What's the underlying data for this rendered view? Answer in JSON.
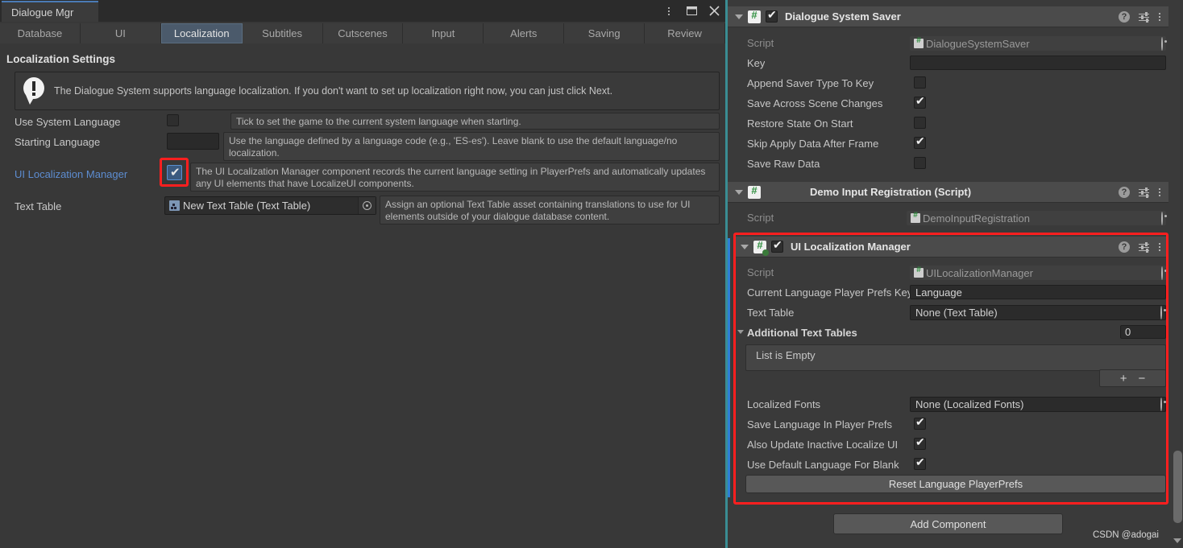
{
  "left_window": {
    "tab_label": "Dialogue Mgr",
    "window_buttons": {
      "menu": "⋮",
      "maximize": "❐",
      "close": "✕"
    },
    "toolbar_tabs": [
      {
        "label": "Database",
        "active": false
      },
      {
        "label": "UI",
        "active": false
      },
      {
        "label": "Localization",
        "active": true
      },
      {
        "label": "Subtitles",
        "active": false
      },
      {
        "label": "Cutscenes",
        "active": false
      },
      {
        "label": "Input",
        "active": false
      },
      {
        "label": "Alerts",
        "active": false
      },
      {
        "label": "Saving",
        "active": false
      },
      {
        "label": "Review",
        "active": false
      }
    ],
    "section_title": "Localization Settings",
    "help_text": "The Dialogue System supports language localization. If you don't want to set up localization right now, you can just click Next.",
    "fields": {
      "use_system_language": {
        "label": "Use System Language",
        "checked": false,
        "tip": "Tick to set the game to the current system language when starting."
      },
      "starting_language": {
        "label": "Starting Language",
        "value": "",
        "tip": "Use the language defined by a language code (e.g., 'ES-es'). Leave blank to use the default language/no localization."
      },
      "ui_localization_manager": {
        "label": "UI Localization Manager",
        "checked": true,
        "highlighted": true,
        "tip": "The UI Localization Manager component records the current language setting in PlayerPrefs and automatically updates any UI elements that have LocalizeUI components."
      },
      "text_table": {
        "label": "Text Table",
        "value": "New Text Table (Text Table)",
        "tip": "Assign an optional Text Table asset containing translations to use for UI elements outside of your dialogue database content."
      }
    }
  },
  "inspector": {
    "components": [
      {
        "title": "Dialogue System Saver",
        "enabled": true,
        "has_enable_checkbox": true,
        "icon": "script-icon",
        "rows": [
          {
            "type": "object",
            "label": "Script",
            "value": "DialogueSystemSaver",
            "dim": true
          },
          {
            "type": "input",
            "label": "Key",
            "value": ""
          },
          {
            "type": "check",
            "label": "Append Saver Type To Key",
            "checked": false
          },
          {
            "type": "check",
            "label": "Save Across Scene Changes",
            "checked": true
          },
          {
            "type": "check",
            "label": "Restore State On Start",
            "checked": false
          },
          {
            "type": "check",
            "label": "Skip Apply Data After Frame",
            "checked": true
          },
          {
            "type": "check",
            "label": "Save Raw Data",
            "checked": false
          }
        ]
      },
      {
        "title": "Demo Input Registration (Script)",
        "enabled": true,
        "has_enable_checkbox": false,
        "icon": "script-icon",
        "rows": [
          {
            "type": "object",
            "label": "Script",
            "value": "DemoInputRegistration",
            "dim": true
          }
        ]
      },
      {
        "title": "UI Localization Manager",
        "enabled": true,
        "has_enable_checkbox": true,
        "icon": "script-add-icon",
        "highlighted": true,
        "selected": true,
        "rows": [
          {
            "type": "object",
            "label": "Script",
            "value": "UILocalizationManager",
            "dim": true
          },
          {
            "type": "input",
            "label": "Current Language Player Prefs Key",
            "value": "Language"
          },
          {
            "type": "object",
            "label": "Text Table",
            "value": "None (Text Table)"
          },
          {
            "type": "foldout_count",
            "label": "Additional Text Tables",
            "count": "0"
          },
          {
            "type": "list",
            "empty_label": "List is Empty",
            "add_label": "+",
            "remove_label": "−"
          },
          {
            "type": "object",
            "label": "Localized Fonts",
            "value": "None (Localized Fonts)"
          },
          {
            "type": "check",
            "label": "Save Language In Player Prefs",
            "checked": true
          },
          {
            "type": "check",
            "label": "Also Update Inactive Localize UI",
            "checked": true
          },
          {
            "type": "check",
            "label": "Use Default Language For Blank",
            "checked": true
          },
          {
            "type": "button",
            "label": "Reset Language PlayerPrefs"
          }
        ]
      }
    ],
    "add_component_label": "Add Component",
    "watermark": "CSDN @adogai"
  },
  "colors": {
    "accent_tab": "#4b5a6b",
    "link": "#5d8dd1",
    "highlight_red": "#ff1f1f",
    "selection_blue": "#2d7fd8",
    "divider_teal": "#3a8d93",
    "panel_bg": "#383838",
    "header_bg": "#4b4b4b"
  }
}
